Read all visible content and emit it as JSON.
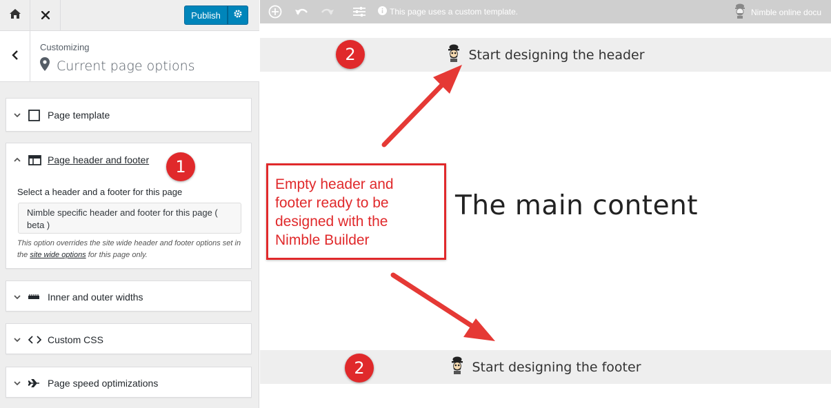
{
  "topbar": {
    "home_icon": "home-icon",
    "close_icon": "close-icon",
    "publish_label": "Publish",
    "publish_settings_icon": "gear-icon",
    "accent_color": "#0085ba"
  },
  "section": {
    "back_icon": "chevron-left-icon",
    "subtitle": "Customizing",
    "title": "Current page options",
    "title_icon": "map-pin-icon"
  },
  "panels": {
    "page_template": {
      "label": "Page template",
      "icon": "checkbox-icon"
    },
    "header_footer": {
      "label": "Page header and footer",
      "icon": "layout-icon",
      "select_label": "Select a header and a footer for this page",
      "selected_value_line1": "Nimble specific header and footer for this page (",
      "selected_value_line2": "beta )",
      "description_prefix": "This option overrides the site wide header and footer options set in the ",
      "description_link": "site wide options",
      "description_suffix": " for this page only."
    },
    "widths": {
      "label": "Inner and outer widths",
      "icon": "ruler-icon"
    },
    "custom_css": {
      "label": "Custom CSS",
      "icon": "code-icon"
    },
    "speed": {
      "label": "Page speed optimizations",
      "icon": "airplane-icon"
    }
  },
  "annotations": {
    "badge_one": "1",
    "badge_two_header": "2",
    "badge_two_footer": "2",
    "badge_color": "#e0292b",
    "callout_text_line1": "Empty header and",
    "callout_text_line2": "footer ready to be",
    "callout_text_line3": "designed with the",
    "callout_text_line4": "Nimble Builder"
  },
  "preview": {
    "toolbar": {
      "add_icon": "plus-circle-icon",
      "undo_icon": "undo-icon",
      "redo_icon": "redo-icon",
      "settings_icon": "sliders-icon",
      "info_icon": "info-icon",
      "notice": "This page uses a custom template.",
      "doc_link": "Nimble online docu",
      "doc_icon": "nimble-mascot-icon"
    },
    "header_band": {
      "text": "Start designing the header",
      "icon": "nimble-mascot-icon"
    },
    "main_content": "The main content",
    "footer_band": {
      "text": "Start designing the footer",
      "icon": "nimble-mascot-icon"
    }
  }
}
